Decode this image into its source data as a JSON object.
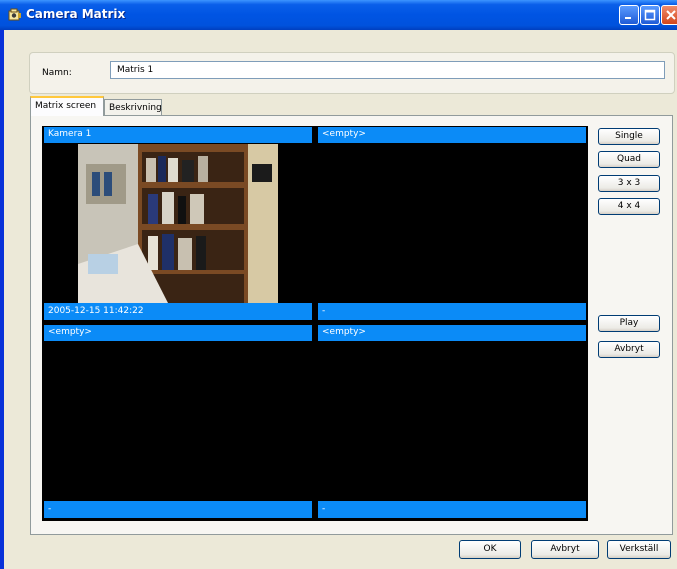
{
  "window": {
    "title": "Camera Matrix",
    "icon": "camera-app-icon"
  },
  "form": {
    "name_label": "Namn:",
    "name_value": "Matris 1"
  },
  "tabs": [
    {
      "label": "Matrix screen",
      "active": true
    },
    {
      "label": "Beskrivning",
      "active": false
    }
  ],
  "matrix": {
    "cells": [
      {
        "header": "Kamera 1",
        "footer": "2005-12-15 11:42:22",
        "has_image": true
      },
      {
        "header": "<empty>",
        "footer": "-",
        "has_image": false
      },
      {
        "header": "<empty>",
        "footer": "-",
        "has_image": false
      },
      {
        "header": "<empty>",
        "footer": "-",
        "has_image": false
      }
    ]
  },
  "layout_buttons": [
    "Single",
    "Quad",
    "3 x 3",
    "4 x 4"
  ],
  "playback_buttons": [
    "Play",
    "Avbryt"
  ],
  "footer_buttons": {
    "ok": "OK",
    "cancel": "Avbryt",
    "apply": "Verkställ"
  },
  "colors": {
    "titlebar": "#0054e3",
    "cell_header": "#0b8bf7",
    "active_tab_accent": "#ffc83c",
    "window_bg": "#ece9d8"
  }
}
